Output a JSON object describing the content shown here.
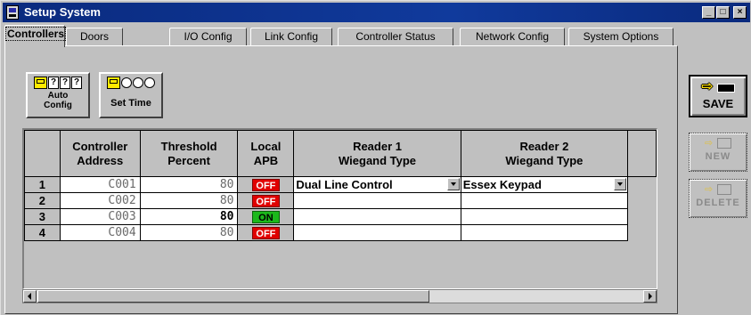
{
  "window": {
    "title": "Setup System",
    "controls": {
      "minimize": "_",
      "maximize": "□",
      "close": "×"
    }
  },
  "tabs": [
    {
      "label": "Controllers",
      "active": true
    },
    {
      "label": "Doors"
    },
    {
      "label": "I/O Config"
    },
    {
      "label": "Link Config"
    },
    {
      "label": "Controller Status"
    },
    {
      "label": "Network Config"
    },
    {
      "label": "System Options"
    }
  ],
  "toolbar": {
    "auto_config_line1": "Auto",
    "auto_config_line2": "Config",
    "auto_config_glyphs": "???",
    "set_time_label": "Set Time"
  },
  "grid": {
    "headers": {
      "address_l1": "Controller",
      "address_l2": "Address",
      "threshold_l1": "Threshold",
      "threshold_l2": "Percent",
      "apb_l1": "Local",
      "apb_l2": "APB",
      "reader1_l1": "Reader 1",
      "reader1_l2": "Wiegand Type",
      "reader2_l1": "Reader 2",
      "reader2_l2": "Wiegand Type"
    },
    "rows": [
      {
        "num": "1",
        "address": "C001",
        "threshold": "80",
        "apb": "OFF",
        "reader1": "Dual Line Control",
        "reader2": "Essex Keypad"
      },
      {
        "num": "2",
        "address": "C002",
        "threshold": "80",
        "apb": "OFF",
        "reader1": "",
        "reader2": ""
      },
      {
        "num": "3",
        "address": "C003",
        "threshold": "80",
        "apb": "ON",
        "reader1": "",
        "reader2": ""
      },
      {
        "num": "4",
        "address": "C004",
        "threshold": "80",
        "apb": "OFF",
        "reader1": "",
        "reader2": ""
      }
    ]
  },
  "actions": {
    "save": "SAVE",
    "new": "NEW",
    "delete": "DELETE"
  },
  "colors": {
    "title_bar": "#0a2a7e",
    "off_badge": "#e00000",
    "on_badge": "#1cb81c",
    "face": "#c0c0c0"
  }
}
